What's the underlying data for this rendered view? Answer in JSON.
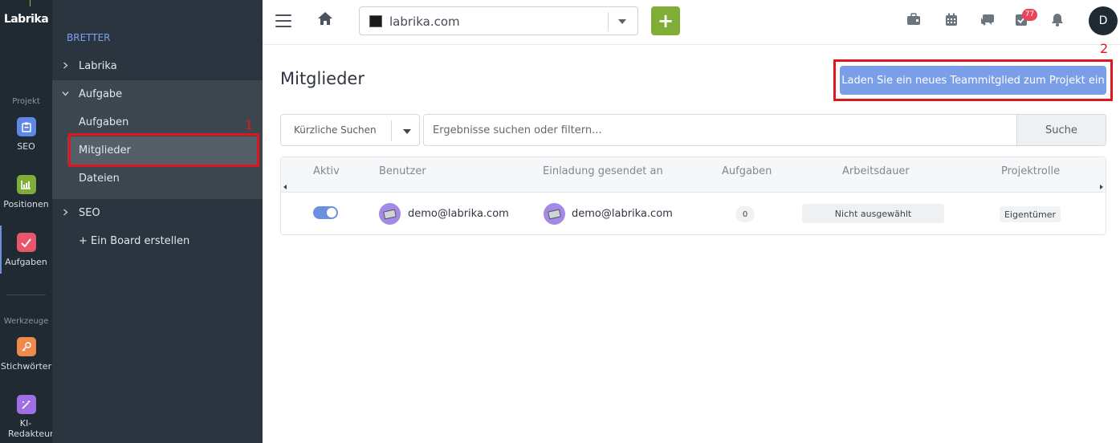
{
  "rail": {
    "logo": "Labrika",
    "section_project": "Projekt",
    "section_tools": "Werkzeuge",
    "items": [
      {
        "label": "SEO",
        "icon": "clipboard-icon",
        "color": "#5f87e5"
      },
      {
        "label": "Positionen",
        "icon": "chart-icon",
        "color": "#7fad38"
      },
      {
        "label": "Aufgaben",
        "icon": "check-icon",
        "color": "#e8566c"
      },
      {
        "label": "Stichwörter",
        "icon": "key-icon",
        "color": "#ef8a4f"
      },
      {
        "label": "KI-Redakteur",
        "icon": "magic-wand-icon",
        "color": "#a06ee6"
      }
    ]
  },
  "boards": {
    "heading": "BRETTER",
    "items": [
      {
        "label": "Labrika",
        "expanded": false
      },
      {
        "label": "Aufgabe",
        "expanded": true
      },
      {
        "label": "SEO",
        "expanded": false
      }
    ],
    "sub_items": [
      {
        "label": "Aufgaben",
        "selected": false
      },
      {
        "label": "Mitglieder",
        "selected": true
      },
      {
        "label": "Dateien",
        "selected": false
      }
    ],
    "create_label": "+ Ein Board erstellen"
  },
  "topbar": {
    "domain": "labrika.com",
    "add_label": "+",
    "notification_count": "77",
    "avatar_initial": "D"
  },
  "main": {
    "title": "Mitglieder",
    "invite_button": "Laden Sie ein neues Teammitglied zum Projekt ein",
    "recent_search": "Kürzliche Suchen",
    "search_placeholder": "Ergebnisse suchen oder filtern...",
    "search_button": "Suche",
    "columns": [
      "Aktiv",
      "Benutzer",
      "Einladung gesendet an",
      "Aufgaben",
      "Arbeitsdauer",
      "Projektrolle"
    ],
    "rows": [
      {
        "active": true,
        "user": "demo@labrika.com",
        "invited": "demo@labrika.com",
        "tasks": "0",
        "duration": "Nicht ausgewählt",
        "role": "Eigentümer"
      }
    ]
  },
  "annotations": {
    "one": "1",
    "two": "2"
  },
  "colors": {
    "rail_bg": "#1f2a33",
    "panel_bg": "#2a353f",
    "accent_blue": "#7b9ee8",
    "add_green": "#7fad38",
    "annotation_red": "#e0161e",
    "badge_red": "#e8445a"
  }
}
